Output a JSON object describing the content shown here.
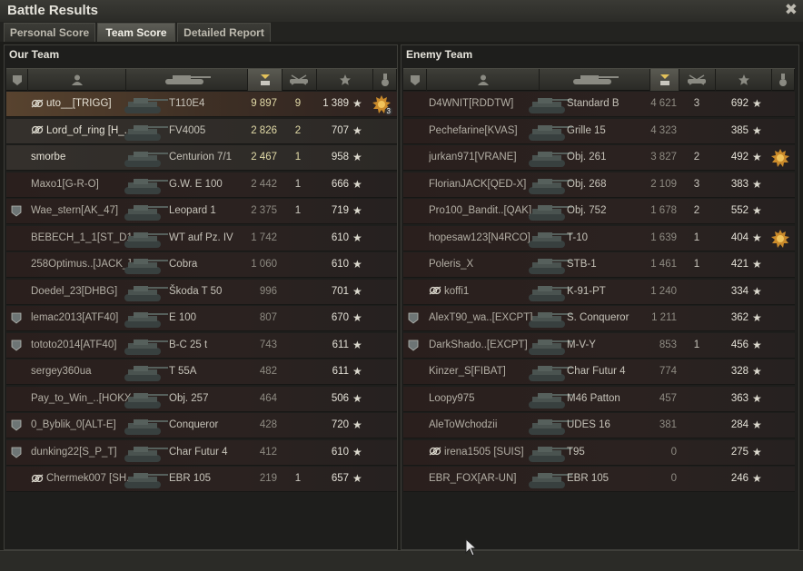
{
  "window": {
    "title": "Battle Results",
    "close_icon": "close-icon"
  },
  "tabs": [
    {
      "label": "Personal Score",
      "active": false
    },
    {
      "label": "Team Score",
      "active": true
    },
    {
      "label": "Detailed Report",
      "active": false
    }
  ],
  "columns": [
    "badge-icon",
    "player-icon",
    "vehicle-icon",
    "xp-icon",
    "kills-icon",
    "score-star-icon",
    "medal-icon"
  ],
  "our_team": {
    "title": "Our Team",
    "rows": [
      {
        "player": "uto__[TRIGG]",
        "icon": "platoon-icon",
        "vehicle": "T110E4",
        "xp": "9 897",
        "kills": "9",
        "score": "1 389",
        "highlight": "self",
        "medal": "3"
      },
      {
        "player": "Lord_of_ring [H_...",
        "icon": "platoon-icon",
        "vehicle": "FV4005",
        "xp": "2 826",
        "kills": "2",
        "score": "707",
        "highlight": "platoon"
      },
      {
        "player": "smorbe",
        "vehicle": "Centurion 7/1",
        "xp": "2 467",
        "kills": "1",
        "score": "958",
        "highlight": "platoon"
      },
      {
        "player": "Maxo1[G-R-O]",
        "vehicle": "G.W. E 100",
        "xp": "2 442",
        "kills": "1",
        "score": "666"
      },
      {
        "player": "Wae_stern[AK_47]",
        "badge": "2",
        "vehicle": "Leopard 1",
        "xp": "2 375",
        "kills": "1",
        "score": "719"
      },
      {
        "player": "BEBECH_1_1[ST_D1]",
        "vehicle": "WT auf Pz. IV",
        "xp": "1 742",
        "kills": "",
        "score": "610"
      },
      {
        "player": "258Optimus..[JACK_]",
        "vehicle": "Cobra",
        "xp": "1 060",
        "kills": "",
        "score": "610"
      },
      {
        "player": "Doedel_23[DHBG]",
        "vehicle": "Škoda T 50",
        "xp": "996",
        "kills": "",
        "score": "701"
      },
      {
        "player": "lemac2013[ATF40]",
        "badge": "1",
        "vehicle": "E 100",
        "xp": "807",
        "kills": "",
        "score": "670"
      },
      {
        "player": "tototo2014[ATF40]",
        "badge": "1",
        "vehicle": "B-C 25 t",
        "xp": "743",
        "kills": "",
        "score": "611"
      },
      {
        "player": "sergey360ua",
        "vehicle": "T 55A",
        "xp": "482",
        "kills": "",
        "score": "611"
      },
      {
        "player": "Pay_to_Win_..[HOKX]",
        "vehicle": "Obj. 257",
        "xp": "464",
        "kills": "",
        "score": "506"
      },
      {
        "player": "0_Byblik_0[ALT-E]",
        "badge": "2",
        "vehicle": "Conqueror",
        "xp": "428",
        "kills": "",
        "score": "720"
      },
      {
        "player": "dunking22[S_P_T]",
        "badge": "2",
        "vehicle": "Char Futur 4",
        "xp": "412",
        "kills": "",
        "score": "610"
      },
      {
        "player": "Chermek007 [SH..",
        "icon": "platoon-icon",
        "vehicle": "EBR 105",
        "xp": "219",
        "kills": "1",
        "score": "657"
      }
    ]
  },
  "enemy_team": {
    "title": "Enemy Team",
    "rows": [
      {
        "player": "D4WNIT[RDDTW]",
        "vehicle": "Standard B",
        "xp": "4 621",
        "kills": "3",
        "score": "692"
      },
      {
        "player": "Pechefarine[KVAS]",
        "vehicle": "Grille 15",
        "xp": "4 323",
        "kills": "",
        "score": "385"
      },
      {
        "player": "jurkan971[VRANE]",
        "vehicle": "Obj. 261",
        "xp": "3 827",
        "kills": "2",
        "score": "492",
        "medal": ""
      },
      {
        "player": "FlorianJACK[QED-X]",
        "vehicle": "Obj. 268",
        "xp": "2 109",
        "kills": "3",
        "score": "383"
      },
      {
        "player": "Pro100_Bandit..[QAK]",
        "vehicle": "Obj. 752",
        "xp": "1 678",
        "kills": "2",
        "score": "552"
      },
      {
        "player": "hopesaw123[N4RCO]",
        "vehicle": "T-10",
        "xp": "1 639",
        "kills": "1",
        "score": "404",
        "medal": ""
      },
      {
        "player": "Poleris_X",
        "vehicle": "STB-1",
        "xp": "1 461",
        "kills": "1",
        "score": "421"
      },
      {
        "player": "koffi1",
        "icon": "platoon-icon",
        "vehicle": "K-91-PT",
        "xp": "1 240",
        "kills": "",
        "score": "334"
      },
      {
        "player": "AlexT90_wa..[EXCPT]",
        "badge": "1",
        "vehicle": "S. Conqueror",
        "xp": "1 211",
        "kills": "",
        "score": "362"
      },
      {
        "player": "DarkShado..[EXCPT]",
        "badge": "1",
        "vehicle": "M-V-Y",
        "xp": "853",
        "kills": "1",
        "score": "456"
      },
      {
        "player": "Kinzer_S[FIBAT]",
        "vehicle": "Char Futur 4",
        "xp": "774",
        "kills": "",
        "score": "328"
      },
      {
        "player": "Loopy975",
        "vehicle": "M46 Patton",
        "xp": "457",
        "kills": "",
        "score": "363"
      },
      {
        "player": "AleToWchodzii",
        "vehicle": "UDES 16",
        "xp": "381",
        "kills": "",
        "score": "284"
      },
      {
        "player": "irena1505 [SUIS]",
        "icon": "platoon-icon",
        "vehicle": "T95",
        "xp": "0",
        "kills": "",
        "score": "275"
      },
      {
        "player": "EBR_FOX[AR-UN]",
        "vehicle": "EBR 105",
        "xp": "0",
        "kills": "",
        "score": "246"
      }
    ]
  }
}
